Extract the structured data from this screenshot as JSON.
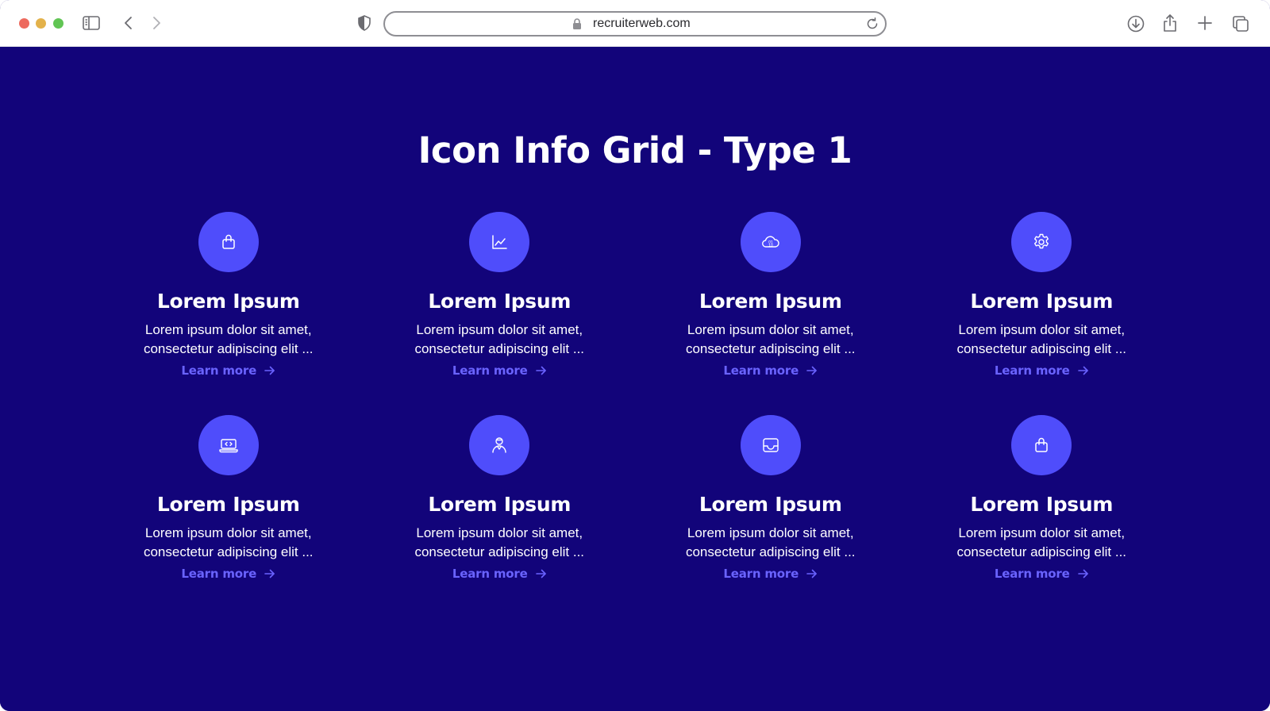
{
  "browser": {
    "url": "recruiterweb.com",
    "colors": {
      "toolbar": "#ffffff",
      "close": "#ed6a5e",
      "minimize": "#e3b24b",
      "maximize": "#61c554"
    },
    "icons": [
      "sidebar-icon",
      "back-icon",
      "forward-icon",
      "shield-icon",
      "lock-icon",
      "reload-icon",
      "download-icon",
      "share-icon",
      "new-tab-icon",
      "tabs-overview-icon"
    ]
  },
  "page": {
    "title": "Icon Info Grid - Type 1",
    "colors": {
      "background": "#12047a",
      "icon_circle": "#4f4dfb",
      "link": "#6a63ff",
      "text": "#ffffff"
    }
  },
  "cards": [
    {
      "icon": "shopping-bag-icon",
      "title": "Lorem Ipsum",
      "line1": "Lorem ipsum dolor sit amet,",
      "line2": "consectetur adipiscing elit ...",
      "link": "Learn more"
    },
    {
      "icon": "line-chart-icon",
      "title": "Lorem Ipsum",
      "line1": "Lorem ipsum dolor sit amet,",
      "line2": "consectetur adipiscing elit ...",
      "link": "Learn more"
    },
    {
      "icon": "cloud-data-icon",
      "title": "Lorem Ipsum",
      "line1": "Lorem ipsum dolor sit amet,",
      "line2": "consectetur adipiscing elit ...",
      "link": "Learn more"
    },
    {
      "icon": "gear-icon",
      "title": "Lorem Ipsum",
      "line1": "Lorem ipsum dolor sit amet,",
      "line2": "consectetur adipiscing elit ...",
      "link": "Learn more"
    },
    {
      "icon": "laptop-code-icon",
      "title": "Lorem Ipsum",
      "line1": "Lorem ipsum dolor sit amet,",
      "line2": "consectetur adipiscing elit ...",
      "link": "Learn more"
    },
    {
      "icon": "user-badge-icon",
      "title": "Lorem Ipsum",
      "line1": "Lorem ipsum dolor sit amet,",
      "line2": "consectetur adipiscing elit ...",
      "link": "Learn more"
    },
    {
      "icon": "inbox-tray-icon",
      "title": "Lorem Ipsum",
      "line1": "Lorem ipsum dolor sit amet,",
      "line2": "consectetur adipiscing elit ...",
      "link": "Learn more"
    },
    {
      "icon": "shopping-bag-icon",
      "title": "Lorem Ipsum",
      "line1": "Lorem ipsum dolor sit amet,",
      "line2": "consectetur adipiscing elit ...",
      "link": "Learn more"
    }
  ]
}
